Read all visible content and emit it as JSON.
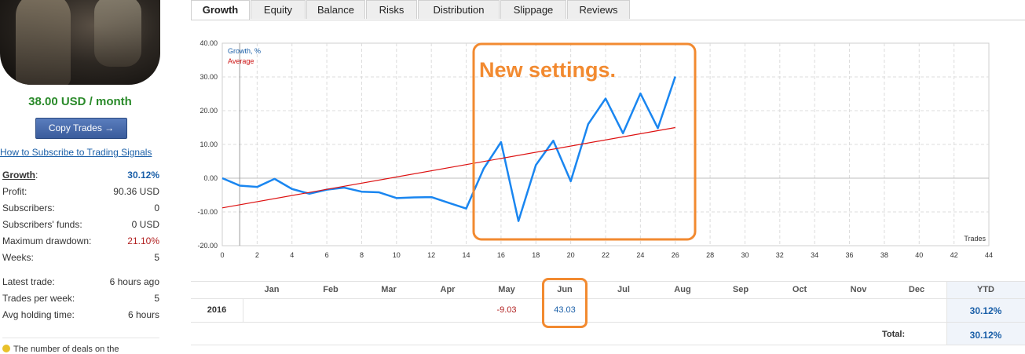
{
  "sidebar": {
    "price": "38.00 USD / month",
    "copy_button": "Copy Trades →",
    "howto_link": "How to Subscribe to Trading Signals",
    "stats": [
      {
        "label": "Growth",
        "suffix": ":",
        "value": "30.12%"
      },
      {
        "label": "Profit:",
        "value": "90.36 USD"
      },
      {
        "label": "Subscribers:",
        "value": "0"
      },
      {
        "label": "Subscribers' funds:",
        "value": "0 USD"
      },
      {
        "label": "Maximum drawdown:",
        "value": "21.10%"
      },
      {
        "label": "Weeks:",
        "value": "5"
      },
      {
        "label": "Latest trade:",
        "value": "6 hours ago"
      },
      {
        "label": "Trades per week:",
        "value": "5"
      },
      {
        "label": "Avg holding time:",
        "value": "6 hours"
      }
    ],
    "note": "The number of deals on the"
  },
  "tabs": [
    "Growth",
    "Equity",
    "Balance",
    "Risks",
    "Distribution",
    "Slippage",
    "Reviews"
  ],
  "active_tab": "Growth",
  "annotation": "New settings.",
  "chart_data": {
    "type": "line",
    "xlabel": "Trades",
    "ylabel": "",
    "xlim": [
      0,
      44
    ],
    "ylim": [
      -20,
      40
    ],
    "x_ticks": [
      0,
      2,
      4,
      6,
      8,
      10,
      12,
      14,
      16,
      18,
      20,
      22,
      24,
      26,
      28,
      30,
      32,
      34,
      36,
      38,
      40,
      42,
      44
    ],
    "y_ticks": [
      "40.00",
      "30.00",
      "20.00",
      "10.00",
      "0.00",
      "-10.00",
      "-20.00"
    ],
    "legend": [
      "Growth, %",
      "Average"
    ],
    "series": [
      {
        "name": "Growth, %",
        "color": "#1a86f0",
        "x": [
          0,
          1,
          2,
          3,
          4,
          5,
          6,
          7,
          8,
          9,
          10,
          11,
          12,
          13,
          14,
          15,
          16,
          17,
          18,
          19,
          20,
          21,
          22,
          23,
          24,
          25,
          26
        ],
        "values": [
          0,
          -2.2,
          -2.6,
          -0.2,
          -3.2,
          -4.6,
          -3.4,
          -2.8,
          -4.0,
          -4.2,
          -5.9,
          -5.7,
          -5.6,
          -7.3,
          -9.0,
          2.8,
          10.7,
          -12.7,
          3.9,
          11.1,
          -0.9,
          16.0,
          23.6,
          13.3,
          25.1,
          14.8,
          30.1
        ]
      },
      {
        "name": "Average",
        "color": "#dd1111",
        "x": [
          0,
          26
        ],
        "values": [
          -8.8,
          15.0
        ]
      }
    ]
  },
  "monthly": {
    "months": [
      "Jan",
      "Feb",
      "Mar",
      "Apr",
      "May",
      "Jun",
      "Jul",
      "Aug",
      "Sep",
      "Oct",
      "Nov",
      "Dec"
    ],
    "ytd_label": "YTD",
    "year": "2016",
    "values": [
      "",
      "",
      "",
      "",
      "-9.03",
      "43.03",
      "",
      "",
      "",
      "",
      "",
      ""
    ],
    "ytd_value": "30.12%",
    "total_label": "Total:",
    "total_value": "30.12%"
  },
  "colors": {
    "accent": "#1a5fa8",
    "highlight": "#f28a30",
    "negative": "#b22222",
    "price": "#2a8a2a"
  }
}
